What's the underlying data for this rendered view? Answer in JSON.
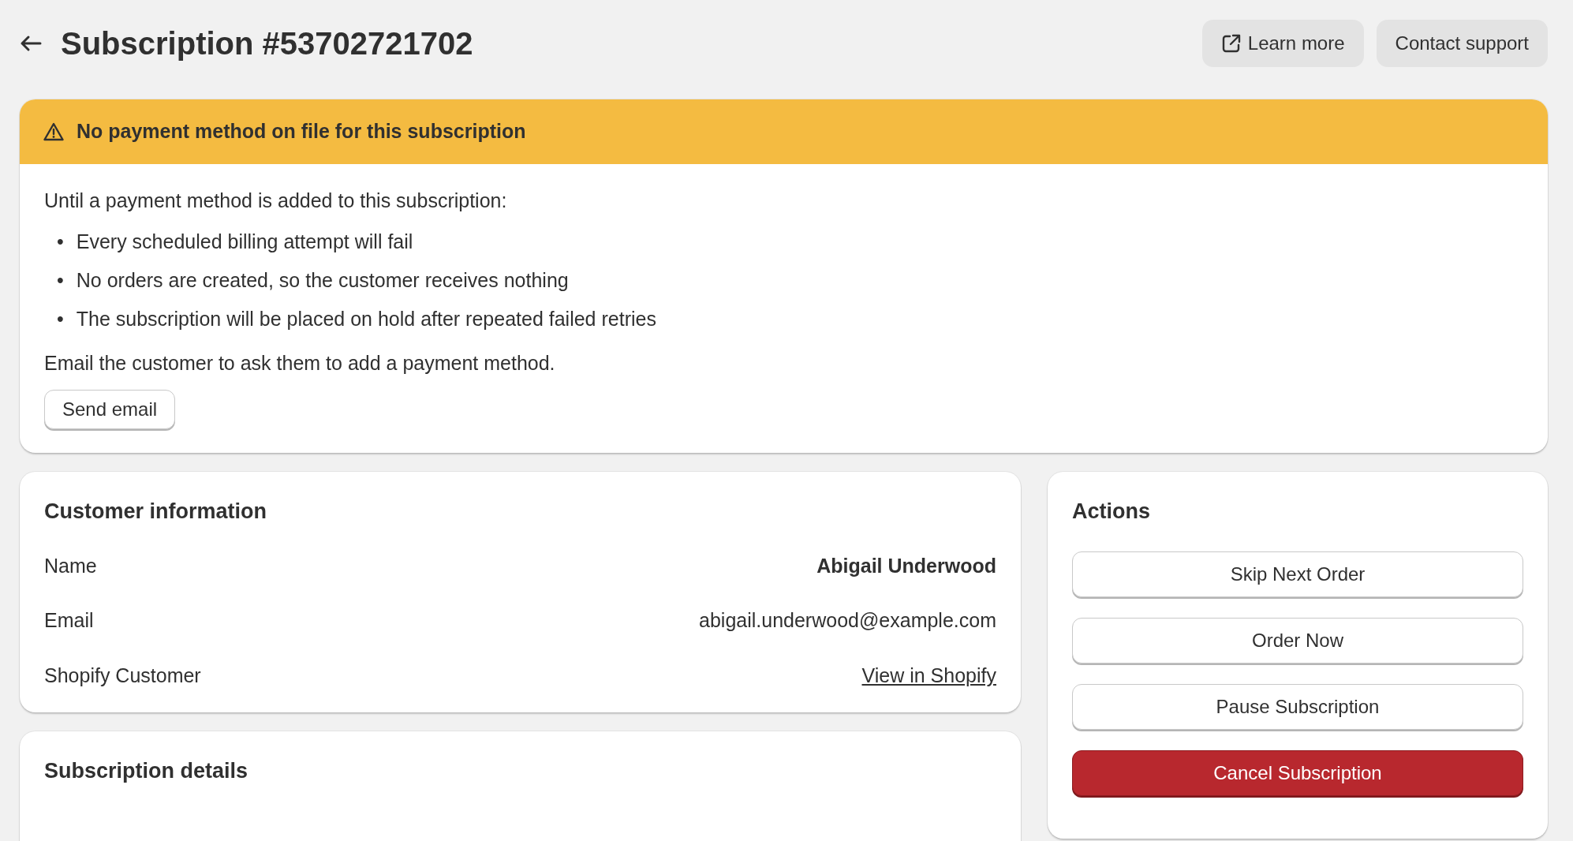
{
  "page": {
    "title": "Subscription #53702721702"
  },
  "header_buttons": [
    {
      "label": "Learn more",
      "kind": "external"
    },
    {
      "label": "Contact support",
      "kind": "plain"
    }
  ],
  "alert": {
    "title": "No payment method on file for this subscription",
    "intro": "Until a payment method is added to this subscription:",
    "bullets": [
      {
        "marker": "•",
        "text": "Every scheduled billing attempt will fail"
      },
      {
        "marker": "•",
        "text": "No orders are created, so the customer receives nothing"
      },
      {
        "marker": "•",
        "text": "The subscription will be placed on hold after repeated failed retries"
      }
    ],
    "note": "Email the customer to ask them to add a payment method.",
    "button": "Send email"
  },
  "customer": {
    "title": "Customer information",
    "rows": [
      {
        "label": "Name",
        "value": "Abigail Underwood",
        "kind": "strong"
      },
      {
        "label": "Email",
        "value": "abigail.underwood@example.com",
        "kind": "text"
      },
      {
        "label": "Shopify Customer",
        "value": "View in Shopify",
        "kind": "link"
      }
    ]
  },
  "details": {
    "title": "Subscription details"
  },
  "actions": {
    "title": "Actions",
    "buttons": [
      {
        "label": "Skip Next Order",
        "kind": "default"
      },
      {
        "label": "Order Now",
        "kind": "default"
      },
      {
        "label": "Pause Subscription",
        "kind": "default"
      },
      {
        "label": "Cancel Subscription",
        "kind": "danger"
      }
    ]
  }
}
